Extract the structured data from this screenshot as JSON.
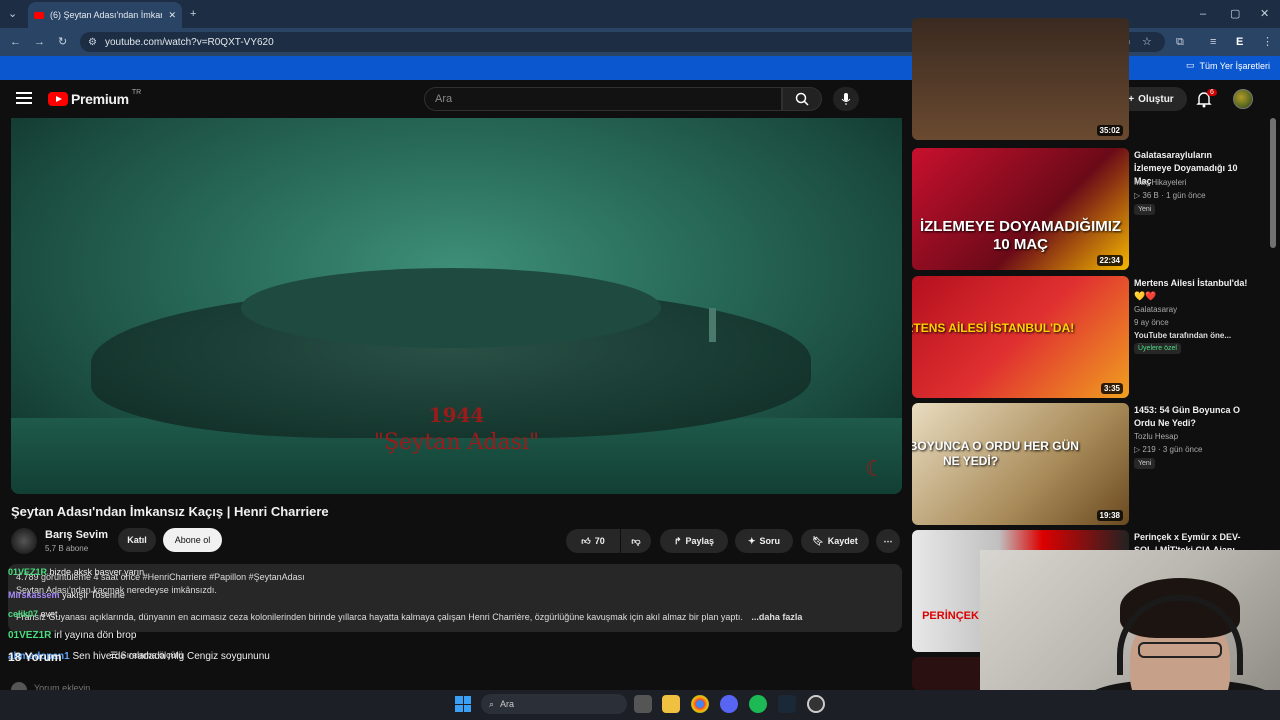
{
  "browser": {
    "tab_title": "(6) Şeytan Adası'ndan İmkansız Kaçış",
    "url": "youtube.com/watch?v=R0QXT-VY620",
    "bookmarks_label": "Tüm Yer İşaretleri",
    "profile_letter": "E"
  },
  "header": {
    "logo_text": "Premium",
    "logo_region": "TR",
    "search_placeholder": "Ara",
    "create_label": "Oluştur",
    "notification_count": "6"
  },
  "player": {
    "overlay_year": "1944",
    "overlay_title": "\"Şeytan Adası\""
  },
  "video": {
    "title": "Şeytan Adası'ndan İmkansız Kaçış | Henri Charriere",
    "channel": "Barış Sevim",
    "subscribers": "5,7 B abone",
    "join_label": "Katıl",
    "subscribe_label": "Abone ol",
    "likes": "70",
    "share_label": "Paylaş",
    "ask_label": "Soru",
    "save_label": "Kaydet"
  },
  "description": {
    "stats": "4.789 görüntüleme  4 saat önce  #HenriCharriere #Papillon #ŞeytanAdası",
    "line1": "Şeytan Adası'ndan kaçmak neredeyse imkânsızdı.",
    "line2": "Fransız Guyanası açıklarında, dünyanın en acımasız ceza kolonilerinden birinde yıllarca hayatta kalmaya çalışan Henri Charrière, özgürlüğüne kavuşmak için akıl almaz bir plan yaptı.",
    "more": "...daha fazla"
  },
  "chat": [
    {
      "name": "01VEZ1R",
      "text": "bizde aksk basver yarın"
    },
    {
      "name": "Mirskassem",
      "text": "yakışır Tosenne"
    },
    {
      "name": "celik07",
      "text": "evet"
    },
    {
      "name": "01VEZ1R",
      "text": "irl yayına dön brop"
    },
    {
      "name": "ahmedopan1",
      "text": "Sen hiverde oradada mlg Cengiz soygununu"
    }
  ],
  "comments": {
    "count": "18 Yorum",
    "sort_label": "Sıralama ölçütü",
    "add_placeholder": "Yorum ekleyin..."
  },
  "recommendations": [
    {
      "duration": "35:02"
    },
    {
      "title": "Galatasarayluların İzlemeye Doyamadığı 10 Maç",
      "channel": "Maç Hikayeleri",
      "meta": "▷ 36 B · 1 gün önce",
      "badge": "Yeni",
      "duration": "22:34",
      "thumb_text": "İZLEMEYE DOYAMADIĞIMIZ 10 MAÇ"
    },
    {
      "title": "Mertens Ailesi İstanbul'da! 💛❤️",
      "channel": "Galatasaray",
      "meta": "9 ay önce",
      "sub_meta": "YouTube tarafından öne...",
      "badge": "Üyelere özel",
      "duration": "3:35",
      "thumb_text": "MERTENS AİLESİ İSTANBUL'DA!"
    },
    {
      "title": "1453: 54 Gün Boyunca O Ordu Ne Yedi?",
      "channel": "Tozlu Hesap",
      "meta": "▷ 219 · 3 gün önce",
      "badge": "Yeni",
      "duration": "19:38",
      "thumb_text": "54 GÜN BOYUNCA O ORDU HER GÜN NE YEDİ?"
    },
    {
      "title": "Perinçek x Eymür x DEV-SOL | MİT'teki CIA Ajanı",
      "thumb_text": "PERİNÇEK"
    }
  ],
  "taskbar": {
    "search_label": "Ara"
  },
  "colors": {
    "yt_red": "#ff0000",
    "chrome_blue": "#0b57d0",
    "chat_green": "#4ade80"
  }
}
